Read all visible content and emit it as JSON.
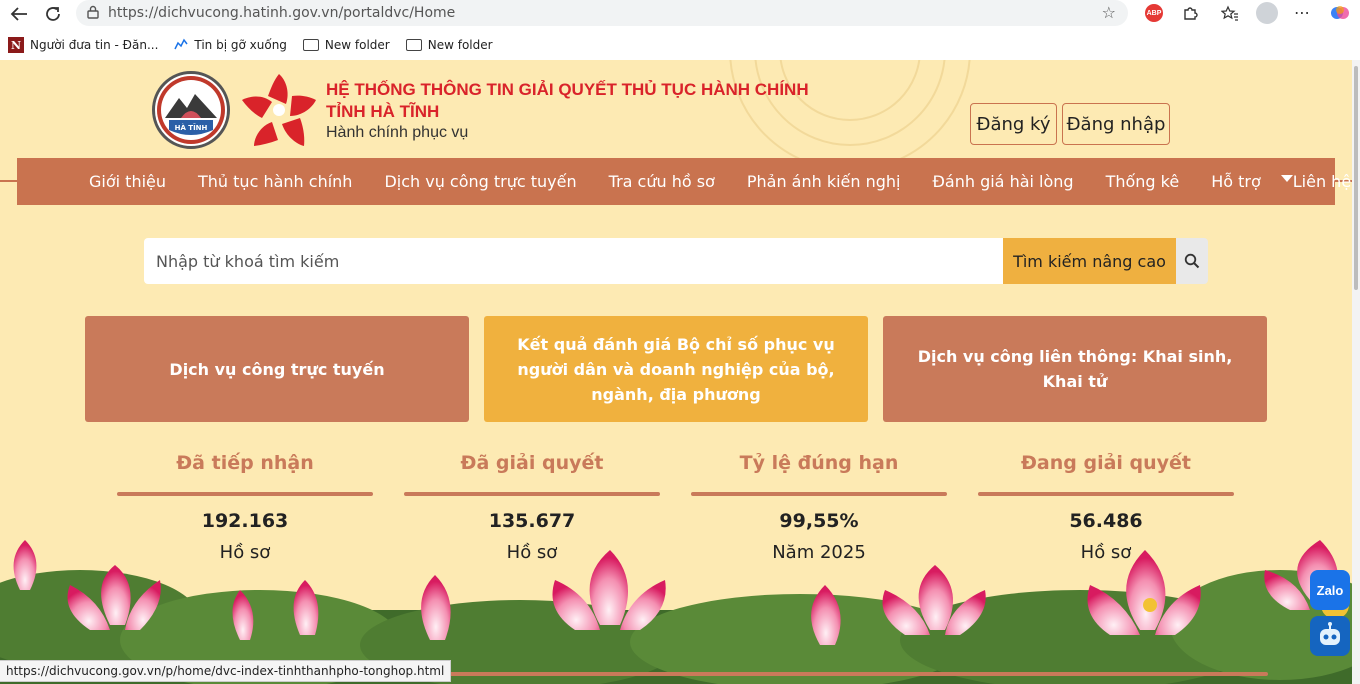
{
  "browser": {
    "url": "https://dichvucong.hatinh.gov.vn/portaldvc/Home",
    "bookmarks": [
      {
        "label": "Người đưa tin - Đăn...",
        "icon": "n-icon"
      },
      {
        "label": "Tin bị gỡ xuống",
        "icon": "chart-icon"
      },
      {
        "label": "New folder",
        "icon": "folder-icon"
      },
      {
        "label": "New folder",
        "icon": "folder-icon"
      }
    ],
    "extensions": {
      "abp_label": "ABP"
    },
    "status_url": "https://dichvucong.gov.vn/p/home/dvc-index-tinhthanhpho-tonghop.html"
  },
  "header": {
    "title_line1": "HỆ THỐNG THÔNG TIN GIẢI QUYẾT THỦ TỤC HÀNH CHÍNH",
    "title_line2": "TỈNH HÀ TĨNH",
    "slogan": "Hành chính phục vụ",
    "register_label": "Đăng ký",
    "login_label": "Đăng nhập"
  },
  "nav": {
    "items": [
      "Giới thiệu",
      "Thủ tục hành chính",
      "Dịch vụ công trực tuyến",
      "Tra cứu hồ sơ",
      "Phản ánh kiến nghị",
      "Đánh giá hài lòng",
      "Thống kê",
      "Hỗ trợ",
      "Liên hệ"
    ]
  },
  "search": {
    "placeholder": "Nhập từ khoá tìm kiếm",
    "advanced_label": "Tìm kiếm nâng cao"
  },
  "cards": [
    {
      "label": "Dịch vụ công trực tuyến"
    },
    {
      "label": "Kết quả đánh giá Bộ chỉ số phục vụ người dân và doanh nghiệp của bộ, ngành, địa phương"
    },
    {
      "label": "Dịch vụ công liên thông: Khai sinh, Khai tử"
    }
  ],
  "stats": [
    {
      "label": "Đã tiếp nhận",
      "value": "192.163",
      "unit": "Hồ sơ"
    },
    {
      "label": "Đã giải quyết",
      "value": "135.677",
      "unit": "Hồ sơ"
    },
    {
      "label": "Tỷ lệ đúng hạn",
      "value": "99,55%",
      "unit": "Năm 2025"
    },
    {
      "label": "Đang giải quyết",
      "value": "56.486",
      "unit": "Hồ sơ"
    }
  ],
  "widgets": {
    "zalo_label": "Zalo"
  },
  "colors": {
    "page_bg": "#fdeab3",
    "nav_bg": "#c9734f",
    "title_red": "#d9232a",
    "accent_orange": "#f0b13e"
  }
}
